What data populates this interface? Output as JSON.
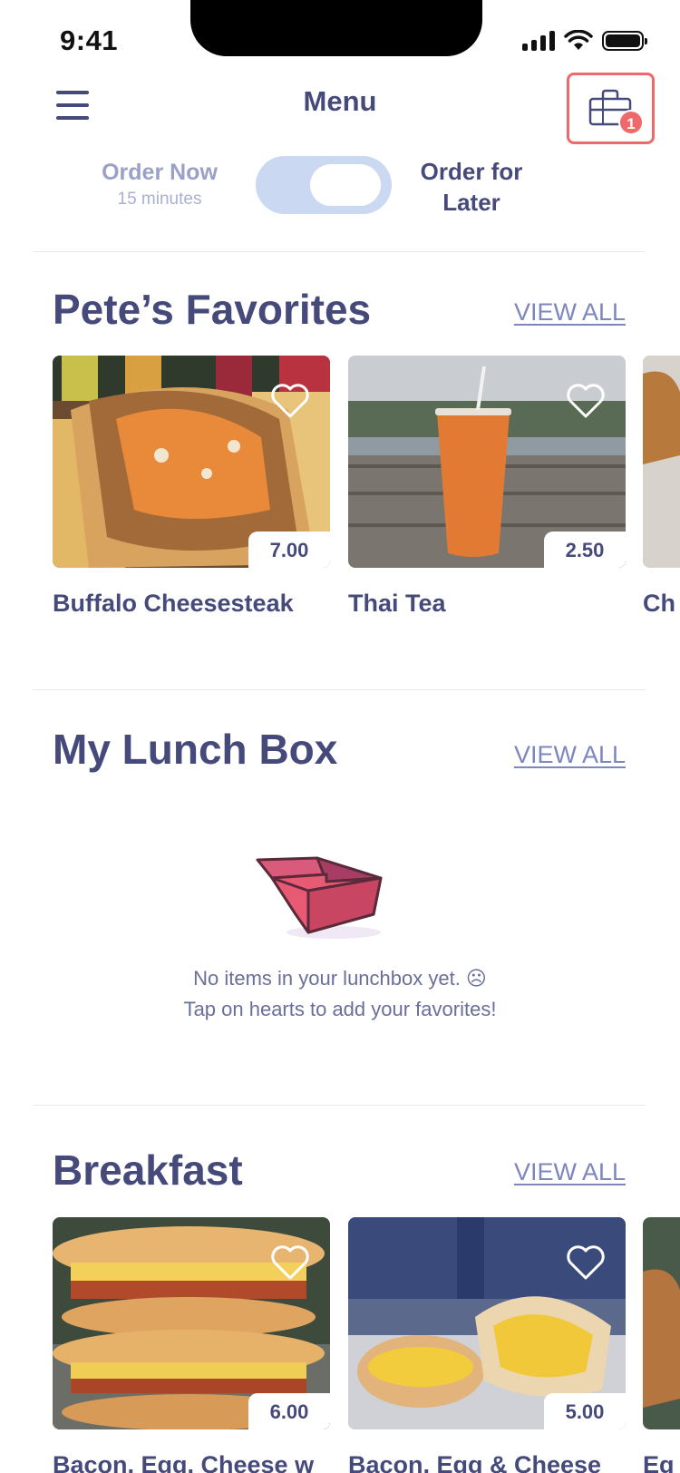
{
  "status_bar": {
    "time": "9:41"
  },
  "header": {
    "title": "Menu",
    "cart_count": "1"
  },
  "order_toggle": {
    "now_label": "Order Now",
    "now_sub": "15 minutes",
    "later_label": "Order for Later"
  },
  "sections": {
    "favorites": {
      "title": "Pete’s Favorites",
      "view_all": "VIEW ALL",
      "items": [
        {
          "name": "Buffalo Cheesesteak",
          "price": "7.00"
        },
        {
          "name": "Thai Tea",
          "price": "2.50"
        },
        {
          "name": "Ch"
        }
      ]
    },
    "lunchbox": {
      "title": "My Lunch Box",
      "view_all": "VIEW ALL",
      "empty_line1": "No items in your lunchbox yet. ☹",
      "empty_line2": "Tap on hearts to add your favorites!"
    },
    "breakfast": {
      "title": "Breakfast",
      "view_all": "VIEW ALL",
      "items": [
        {
          "name": "Bacon, Egg, Cheese w",
          "price": "6.00"
        },
        {
          "name": "Bacon, Egg & Cheese",
          "price": "5.00"
        },
        {
          "name": "Eg"
        }
      ]
    }
  }
}
